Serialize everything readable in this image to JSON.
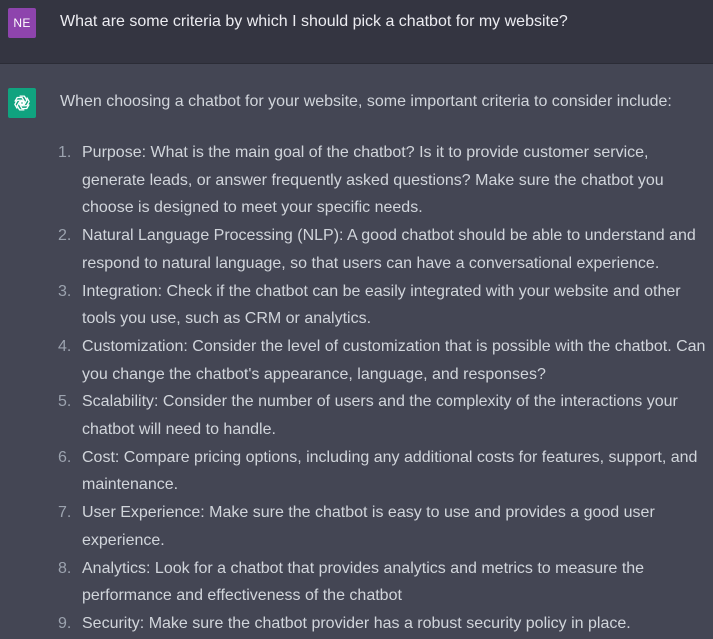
{
  "user": {
    "avatar_initials": "NE",
    "avatar_color": "#8e44ad",
    "message": "What are some criteria by which I should pick a chatbot for my website?"
  },
  "assistant": {
    "avatar_icon": "openai-logo-icon",
    "avatar_color": "#10a37f",
    "intro": "When choosing a chatbot for your website, some important criteria to consider include:",
    "items": [
      {
        "number": "1.",
        "text": "Purpose: What is the main goal of the chatbot? Is it to provide customer service, generate leads, or answer frequently asked questions? Make sure the chatbot you choose is designed to meet your specific needs."
      },
      {
        "number": "2.",
        "text": "Natural Language Processing (NLP): A good chatbot should be able to understand and respond to natural language, so that users can have a conversational experience."
      },
      {
        "number": "3.",
        "text": "Integration: Check if the chatbot can be easily integrated with your website and other tools you use, such as CRM or analytics."
      },
      {
        "number": "4.",
        "text": "Customization: Consider the level of customization that is possible with the chatbot. Can you change the chatbot's appearance, language, and responses?"
      },
      {
        "number": "5.",
        "text": "Scalability: Consider the number of users and the complexity of the interactions your chatbot will need to handle."
      },
      {
        "number": "6.",
        "text": "Cost: Compare pricing options, including any additional costs for features, support, and maintenance."
      },
      {
        "number": "7.",
        "text": "User Experience: Make sure the chatbot is easy to use and provides a good user experience."
      },
      {
        "number": "8.",
        "text": "Analytics: Look for a chatbot that provides analytics and metrics to measure the performance and effectiveness of the chatbot"
      },
      {
        "number": "9.",
        "text": "Security: Make sure the chatbot provider has a robust security policy in place."
      }
    ]
  }
}
